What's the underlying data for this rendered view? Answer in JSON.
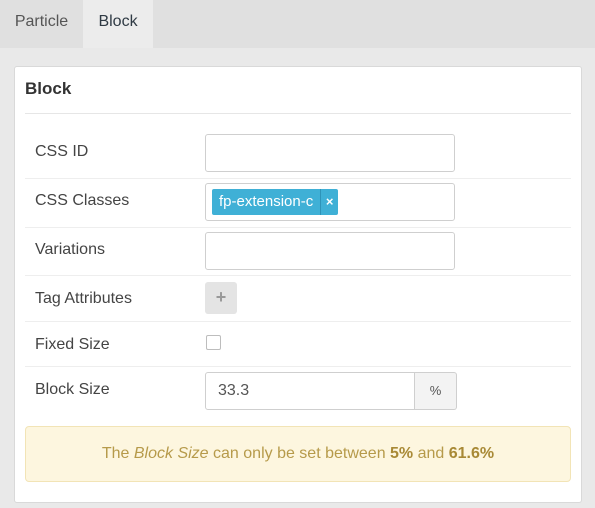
{
  "tabs": [
    {
      "label": "Particle"
    },
    {
      "label": "Block"
    }
  ],
  "panel": {
    "title": "Block"
  },
  "fields": {
    "css_id": {
      "label": "CSS ID",
      "value": ""
    },
    "css_classes": {
      "label": "CSS Classes",
      "tag": "fp-extension-c",
      "tag_remove": "×"
    },
    "variations": {
      "label": "Variations",
      "value": ""
    },
    "tag_attributes": {
      "label": "Tag Attributes",
      "add_icon": "+"
    },
    "fixed_size": {
      "label": "Fixed Size",
      "checked": false
    },
    "block_size": {
      "label": "Block Size",
      "value": "33.3",
      "unit": "%"
    }
  },
  "notice": {
    "prefix": "The ",
    "field": "Block Size",
    "middle": " can only be set between ",
    "min": "5%",
    "and": " and ",
    "max": "61.6%"
  },
  "colors": {
    "tag_bg": "#3fb0d6",
    "notice_bg": "#fdf6df",
    "notice_text": "#b69a4a"
  }
}
